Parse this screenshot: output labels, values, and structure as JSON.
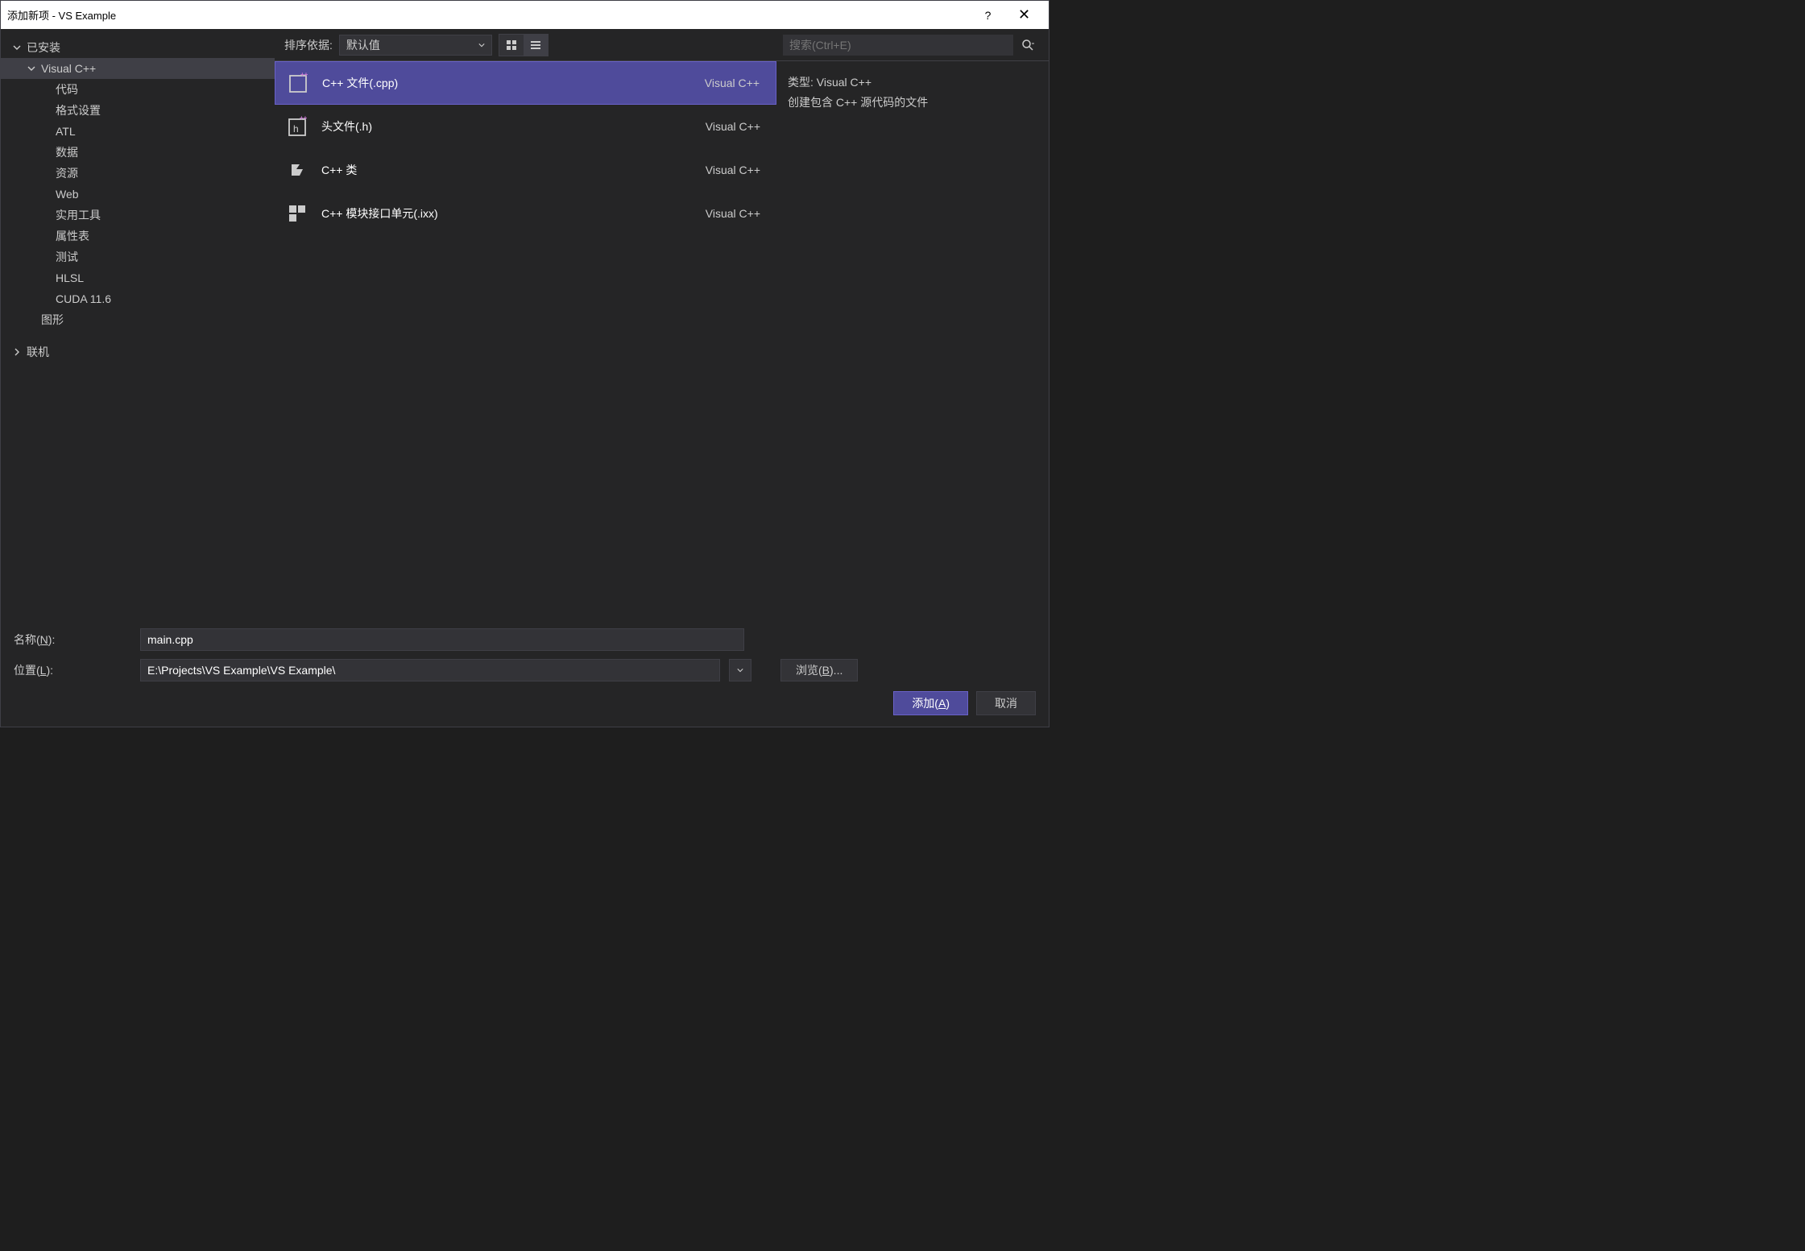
{
  "window": {
    "title": "添加新项 - VS Example",
    "help": "?",
    "close": "✕"
  },
  "tree": {
    "root_installed": "已安装",
    "visual_cpp": "Visual C++",
    "items": [
      "代码",
      "格式设置",
      "ATL",
      "数据",
      "资源",
      "Web",
      "实用工具",
      "属性表",
      "测试",
      "HLSL",
      "CUDA 11.6"
    ],
    "graphics": "图形",
    "online": "联机"
  },
  "toolbar": {
    "sort_label": "排序依据:",
    "sort_value": "默认值"
  },
  "templates": [
    {
      "name": "C++ 文件(.cpp)",
      "lang": "Visual C++",
      "icon": "cpp",
      "selected": true
    },
    {
      "name": "头文件(.h)",
      "lang": "Visual C++",
      "icon": "h",
      "selected": false
    },
    {
      "name": "C++ 类",
      "lang": "Visual C++",
      "icon": "class",
      "selected": false
    },
    {
      "name": "C++ 模块接口单元(.ixx)",
      "lang": "Visual C++",
      "icon": "module",
      "selected": false
    }
  ],
  "search": {
    "placeholder": "搜索(Ctrl+E)"
  },
  "info": {
    "type_label": "类型:",
    "type_value": "Visual C++",
    "description": "创建包含 C++ 源代码的文件"
  },
  "form": {
    "name_label_pre": "名称(",
    "name_label_u": "N",
    "name_label_post": "):",
    "name_value": "main.cpp",
    "location_label_pre": "位置(",
    "location_label_u": "L",
    "location_label_post": "):",
    "location_value": "E:\\Projects\\VS Example\\VS Example\\",
    "browse_pre": "浏览(",
    "browse_u": "B",
    "browse_post": ")..."
  },
  "actions": {
    "add_pre": "添加(",
    "add_u": "A",
    "add_post": ")",
    "cancel": "取消"
  }
}
